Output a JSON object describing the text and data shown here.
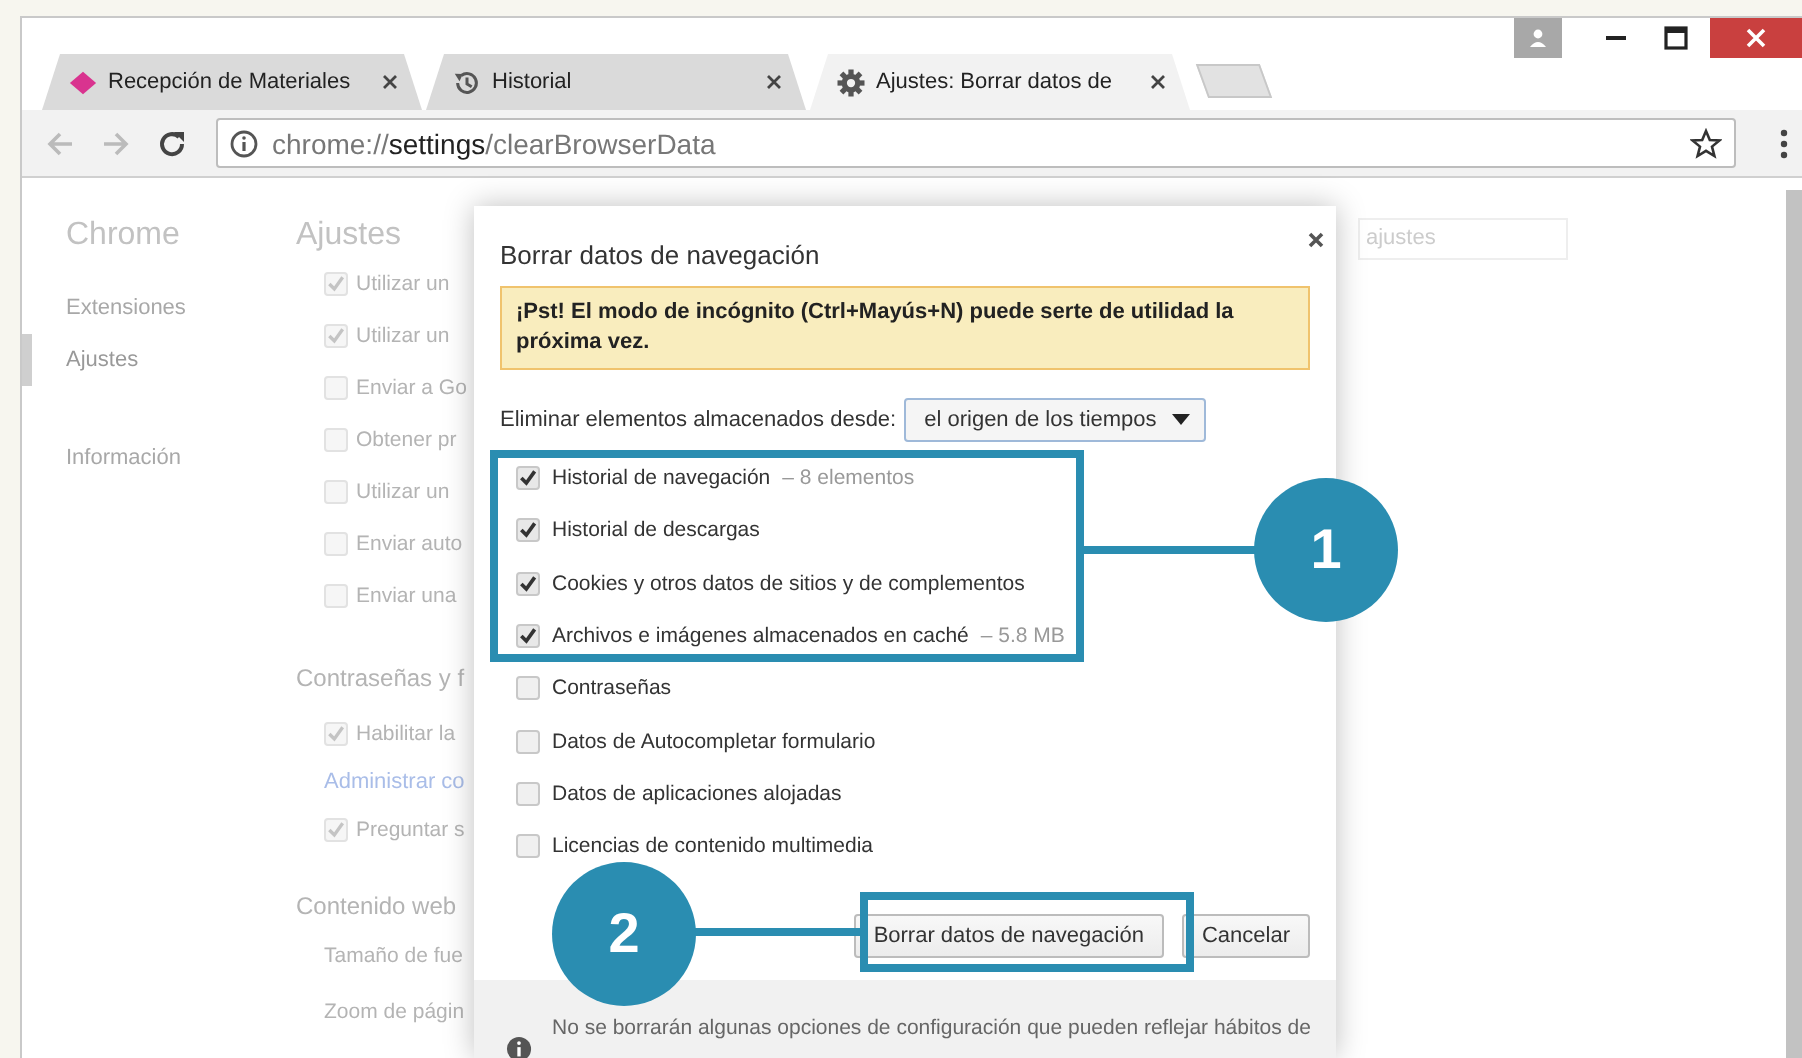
{
  "tabs": [
    {
      "title": "Recepción de Materiales",
      "kind": "diamond",
      "selected": false
    },
    {
      "title": "Historial",
      "kind": "history",
      "selected": false
    },
    {
      "title": "Ajustes: Borrar datos de",
      "kind": "gear",
      "selected": true
    }
  ],
  "address_bar": {
    "url": "chrome://**settings**/clearBrowserData"
  },
  "sidebar": {
    "title": "Chrome",
    "items": [
      {
        "label": "Extensiones",
        "selected": false
      },
      {
        "label": "Ajustes",
        "selected": true
      },
      {
        "label": "Información",
        "selected": false
      }
    ]
  },
  "settings_page": {
    "title": "Ajustes",
    "search": {
      "placeholder": "ajustes"
    },
    "sections": [
      {
        "items": [
          {
            "kind": "checkbox",
            "label": "Utilizar un",
            "checked": true
          },
          {
            "kind": "checkbox",
            "label": "Utilizar un",
            "checked": true
          },
          {
            "kind": "checkbox",
            "label": "Enviar a Go",
            "checked": false
          },
          {
            "kind": "checkbox",
            "label": "Obtener pr",
            "checked": false
          },
          {
            "kind": "checkbox",
            "label": "Utilizar un",
            "checked": false
          },
          {
            "kind": "checkbox",
            "label": "Enviar auto",
            "checked": false
          },
          {
            "kind": "checkbox",
            "label": "Enviar una",
            "checked": false
          }
        ]
      },
      {
        "heading": "Contraseñas y f",
        "items": [
          {
            "kind": "checkbox",
            "label": "Habilitar la",
            "checked": true
          },
          {
            "kind": "link",
            "label": "Administrar co"
          },
          {
            "kind": "checkbox",
            "label": "Preguntar s",
            "checked": true
          }
        ]
      },
      {
        "heading": "Contenido web",
        "items": [
          {
            "kind": "setting",
            "label": "Tamaño de fue"
          },
          {
            "kind": "setting",
            "label": "Zoom de págin"
          }
        ]
      }
    ]
  },
  "dialog": {
    "title": "Borrar datos de navegación",
    "notice": "¡Pst! El modo de incógnito (Ctrl+Mayús+N) puede serte de utilidad la próxima vez.",
    "range_label": "Eliminar elementos almacenados desde:",
    "range_select": {
      "value": "el origen de los tiempos"
    },
    "options": [
      {
        "label": "Historial de navegación",
        "detail": "– 8 elementos",
        "checked": true
      },
      {
        "label": "Historial de descargas",
        "checked": true
      },
      {
        "label": "Cookies y otros datos de sitios y de complementos",
        "checked": true
      },
      {
        "label": "Archivos e imágenes almacenados en caché",
        "detail": "– 5.8 MB",
        "checked": true
      },
      {
        "label": "Contraseñas",
        "checked": false
      },
      {
        "label": "Datos de Autocompletar formulario",
        "checked": false
      },
      {
        "label": "Datos de aplicaciones alojadas",
        "checked": false
      },
      {
        "label": "Licencias de contenido multimedia",
        "checked": false
      }
    ],
    "buttons": [
      {
        "label": "Borrar datos de navegación"
      },
      {
        "label": "Cancelar"
      }
    ],
    "footer_note": "No se borrarán algunas opciones de configuración que pueden reflejar hábitos de"
  },
  "annotations": [
    {
      "label": "1"
    },
    {
      "label": "2"
    }
  ]
}
